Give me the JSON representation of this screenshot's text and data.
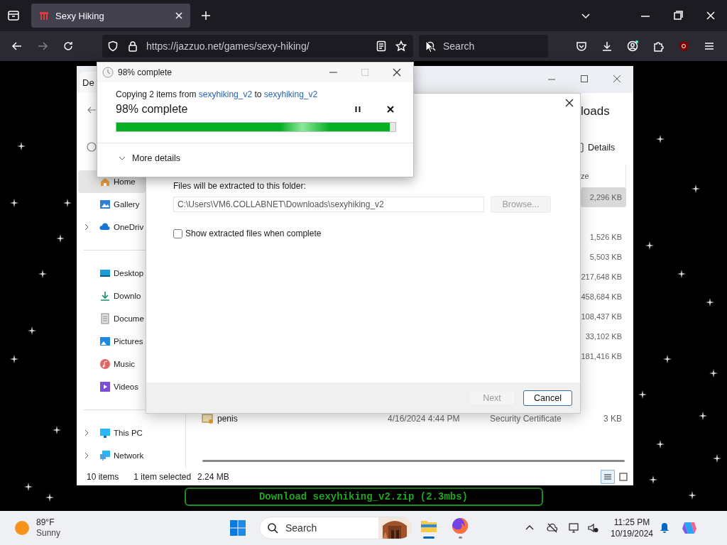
{
  "browser": {
    "tab": {
      "title": "Sexy Hiking",
      "selected": true
    },
    "forward": {
      "disabled": true
    },
    "url": "https://jazzuo.net/games/sexy-hiking/",
    "search": {
      "placeholder": "Search"
    }
  },
  "page": {
    "download_button": "Download sexyhiking_v2.zip (2.3mbs)"
  },
  "explorer": {
    "tab_label": "De",
    "heading": "loads",
    "details_button": "Details",
    "size_header": "ze",
    "nav_groups": [
      [
        {
          "label": "Home",
          "selected": true,
          "expandable": false
        },
        {
          "label": "Gallery",
          "selected": false,
          "expandable": false
        },
        {
          "label": "OneDriv",
          "selected": false,
          "expandable": true
        }
      ],
      [
        {
          "label": "Desktop",
          "selected": false,
          "expandable": false
        },
        {
          "label": "Downlo",
          "selected": false,
          "expandable": false
        },
        {
          "label": "Docume",
          "selected": false,
          "expandable": false
        },
        {
          "label": "Pictures",
          "selected": false,
          "expandable": false
        },
        {
          "label": "Music",
          "selected": false,
          "expandable": false
        },
        {
          "label": "Videos",
          "selected": false,
          "expandable": false
        }
      ],
      [
        {
          "label": "This PC",
          "selected": false,
          "expandable": true
        },
        {
          "label": "Network",
          "selected": false,
          "expandable": true
        }
      ]
    ],
    "size_rows": [
      {
        "size": "2,296 KB",
        "selected": true
      },
      {
        "size": "1,526 KB",
        "selected": false
      },
      {
        "size": "5,503 KB",
        "selected": false
      },
      {
        "size": "217,648 KB",
        "selected": false
      },
      {
        "size": "458,684 KB",
        "selected": false
      },
      {
        "size": "108,437 KB",
        "selected": false
      },
      {
        "size": "33,102 KB",
        "selected": false
      },
      {
        "size": "181,416 KB",
        "selected": false
      }
    ],
    "file_row": {
      "name": "penis",
      "date": "4/16/2024 4:44 PM",
      "type": "Security Certificate",
      "size": "3 KB"
    },
    "status": {
      "count": "10 items",
      "selection": "1 item selected",
      "selection_size": "2.24 MB"
    },
    "views": [
      {
        "selected": true
      },
      {
        "selected": false
      }
    ]
  },
  "extract_dialog": {
    "folder_label": "Files will be extracted to this folder:",
    "path": "C:\\Users\\VM6.COLLABNET\\Downloads\\sexyhiking_v2",
    "browse": {
      "label": "Browse...",
      "disabled": true
    },
    "show_files": {
      "label": "Show extracted files when complete",
      "checked": false
    },
    "next": {
      "label": "Next",
      "disabled": true
    },
    "cancel": {
      "label": "Cancel",
      "disabled": false
    }
  },
  "copy_dialog": {
    "title": "98% complete",
    "summary": {
      "before": "Copying 2 items from ",
      "source": "sexyhiking_v2",
      "middle": " to ",
      "target": "sexyhiking_v2"
    },
    "status": "98% complete",
    "level": 0.98,
    "more_details": "More details"
  },
  "taskbar": {
    "weather": {
      "temperature": "89°F",
      "condition": "Sunny"
    },
    "search": {
      "placeholder": "Search"
    },
    "apps": [
      {
        "active": true
      },
      {
        "active": false
      }
    ],
    "time": "11:25 PM",
    "date": "10/19/2024"
  }
}
